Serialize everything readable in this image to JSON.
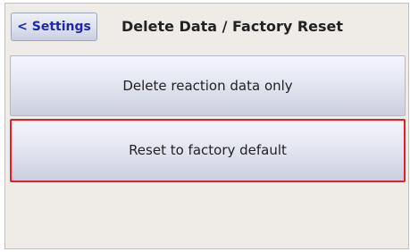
{
  "header": {
    "back_label": "< Settings",
    "title": "Delete Data / Factory Reset"
  },
  "menu": {
    "items": [
      {
        "label": "Delete reaction data only"
      },
      {
        "label": "Reset to factory default",
        "selected": true
      }
    ]
  },
  "colors": {
    "background": "#efece7",
    "back_text": "#1c28a6",
    "selection_border": "#e0202a"
  }
}
